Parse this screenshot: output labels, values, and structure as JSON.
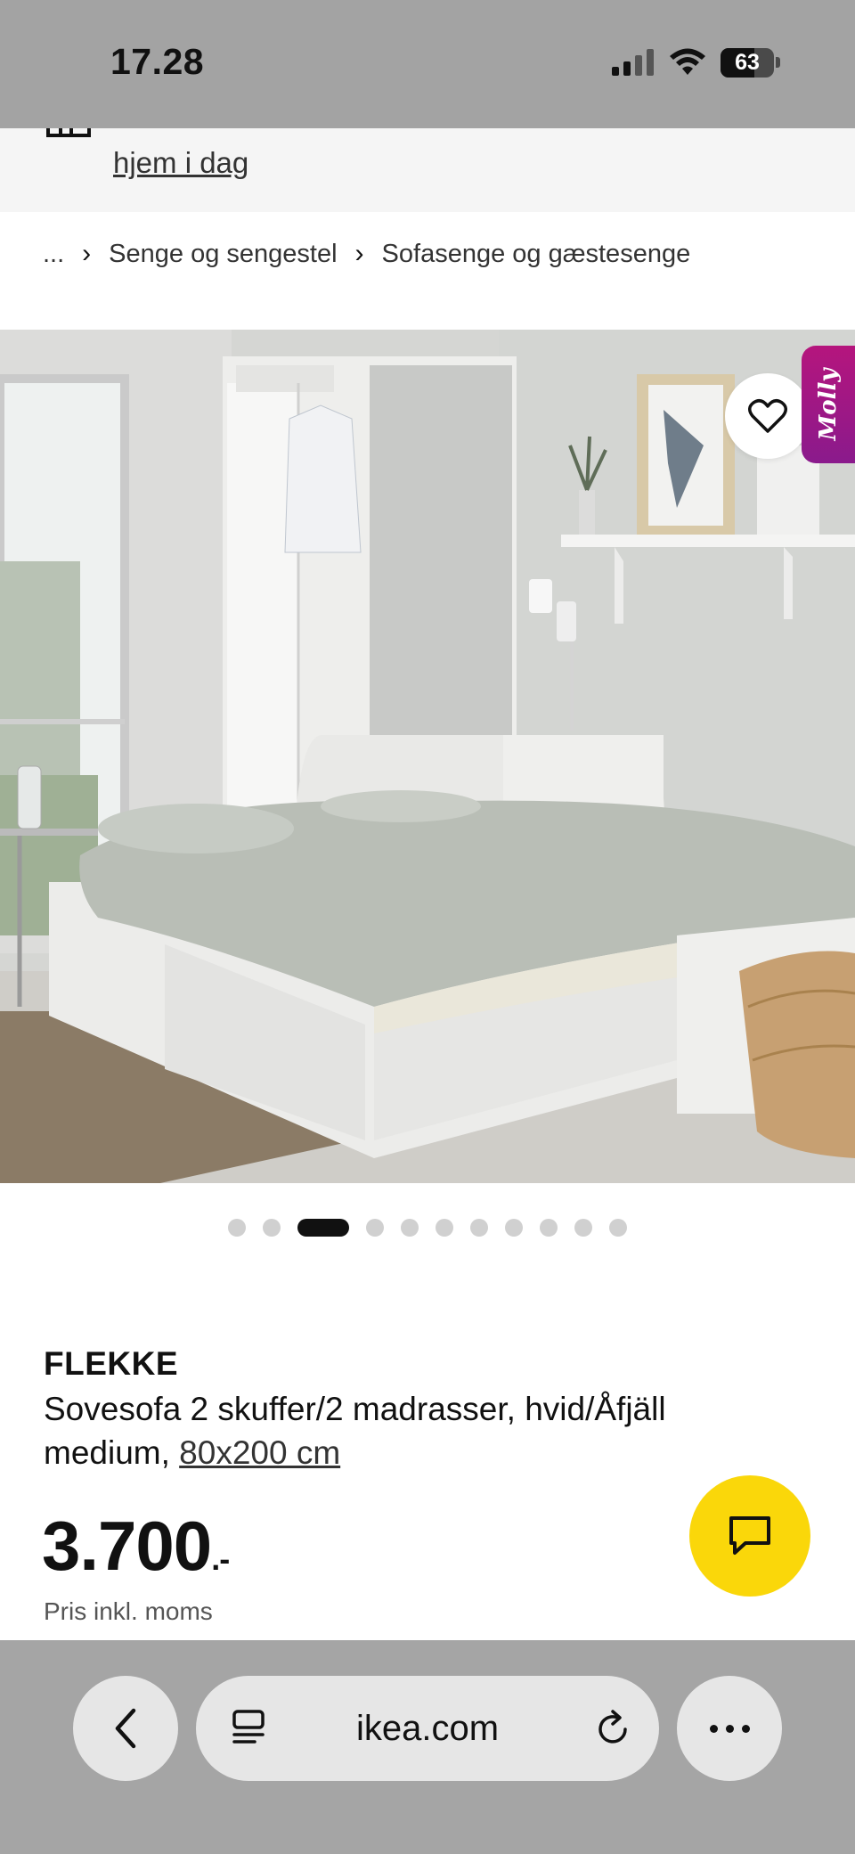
{
  "status_bar": {
    "time": "17.28",
    "battery": "63",
    "battery_level": 0.63,
    "icons": [
      "signal-icon",
      "wifi-icon",
      "battery-icon"
    ]
  },
  "banner": {
    "link_text": "hjem i dag"
  },
  "breadcrumb": {
    "ellipsis": "...",
    "items": [
      "Senge og sengestel",
      "Sofasenge og gæstesenge"
    ],
    "separator": "›"
  },
  "gallery": {
    "molly_label": "Molly",
    "image_count": 11,
    "active_index": 2
  },
  "product": {
    "brand": "FLEKKE",
    "description": "Sovesofa 2 skuffer/2 madrasser, hvid/Åfjäll medium,",
    "size": "80x200 cm",
    "price": "3.700",
    "price_suffix": ".-",
    "price_note": "Pris inkl. moms"
  },
  "browser": {
    "domain": "ikea.com"
  },
  "colors": {
    "status_bar_bg": "#a3a3a3",
    "chat_button": "#fad70a",
    "molly_tab": "#b5157d",
    "browser_bar_bg": "#a5a5a5"
  }
}
